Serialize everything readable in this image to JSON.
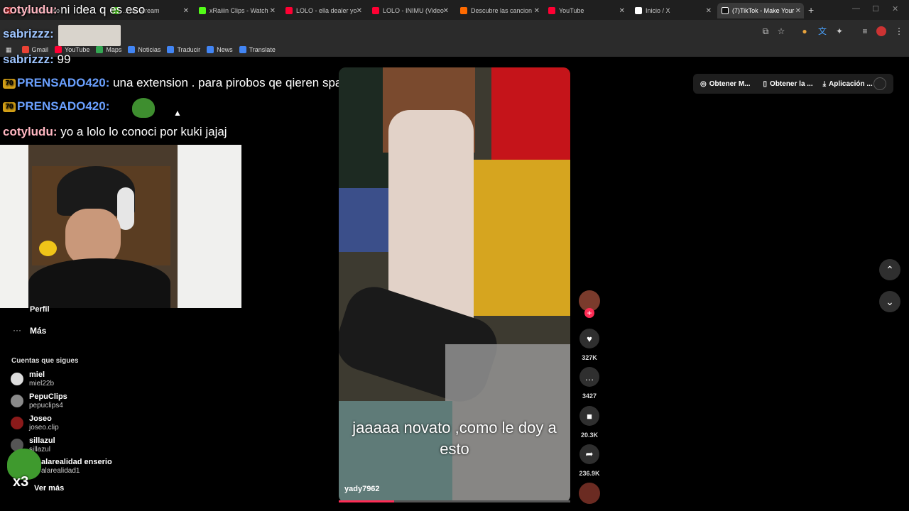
{
  "browser": {
    "tabs": [
      {
        "title": "ni idea q es eso",
        "fav": "#ff4444"
      },
      {
        "title": "... de Stream",
        "fav": "#53fc18"
      },
      {
        "title": "xRaiiin Clips - Watch",
        "fav": "#53fc18"
      },
      {
        "title": "LOLO - ella dealer yo",
        "fav": "#ff0033"
      },
      {
        "title": "LOLO - INIMU (Video",
        "fav": "#ff0033"
      },
      {
        "title": "Descubre las cancion",
        "fav": "#ff6a00"
      },
      {
        "title": "YouTube",
        "fav": "#ff0033"
      },
      {
        "title": "Inicio / X",
        "fav": "#ffffff"
      },
      {
        "title": "(7)TikTok - Make Your",
        "fav": "#ffffff"
      }
    ],
    "new_tab": "+",
    "bookmarks": [
      {
        "label": "Gmail",
        "color": "#ea4335"
      },
      {
        "label": "YouTube",
        "color": "#ff0033"
      },
      {
        "label": "Maps",
        "color": "#34a853"
      },
      {
        "label": "Noticias",
        "color": "#4285f4"
      },
      {
        "label": "Traducir",
        "color": "#4285f4"
      },
      {
        "label": "News",
        "color": "#4285f4"
      },
      {
        "label": "Translate",
        "color": "#4285f4"
      }
    ]
  },
  "chat": [
    {
      "user": "cotyludu:",
      "msg": " ni idea q es eso",
      "color": "#ffb6c1"
    },
    {
      "user": "sabrizzz:",
      "msg": "",
      "color": "#9ec5ff"
    },
    {
      "user": "sabrizzz:",
      "msg": " 99",
      "color": "#9ec5ff"
    },
    {
      "badge": "70",
      "user": "PRENSADO420:",
      "msg": " una extension . para pirobos qe qieren spamiar",
      "color": "#6aa0ff"
    },
    {
      "badge": "70",
      "user": "PRENSADO420:",
      "msg": "",
      "color": "#6aa0ff"
    },
    {
      "user": "cotyludu:",
      "msg": " yo a lolo lo conoci por kuki jajaj",
      "color": "#ffb6c1"
    }
  ],
  "sidebar": {
    "profile_label": "Perfil",
    "more_label": "Más",
    "following_header": "Cuentas que sigues",
    "following": [
      {
        "name": "miel",
        "handle": "miel22b"
      },
      {
        "name": "PepuClips",
        "handle": "pepuclips4"
      },
      {
        "name": "Joseo",
        "handle": "joseo.clip"
      },
      {
        "name": "sillazul",
        "handle": "sillazul"
      },
      {
        "name": "alarealidad enserio",
        "handle": "alarealidad1"
      }
    ],
    "see_more": "Ver más",
    "emote_count": "x3"
  },
  "header": {
    "btn1": "Obtener M...",
    "btn2": "Obtener la ...",
    "btn3": "Aplicación ..."
  },
  "video": {
    "caption": "jaaaaa novato ,como le doy a esto",
    "author": "yady7962",
    "progress": 0.24,
    "likes": "327K",
    "comments": "3427",
    "saves": "20.3K",
    "shares": "236.9K"
  }
}
